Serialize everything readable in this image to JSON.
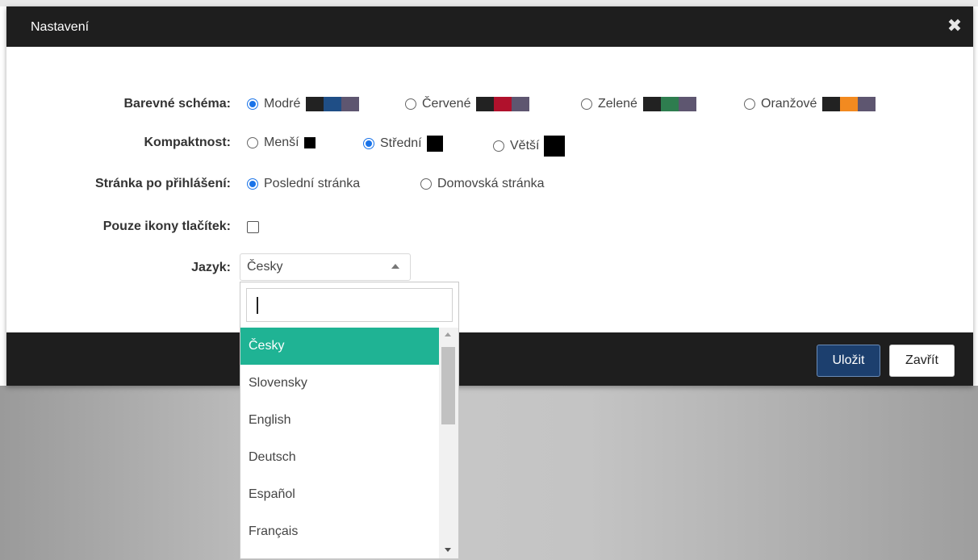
{
  "dialog": {
    "title": "Nastavení",
    "close_icon": "close-x-icon"
  },
  "settings": {
    "color_scheme": {
      "label": "Barevné schéma:",
      "options": [
        {
          "label": "Modré",
          "selected": true,
          "colors": [
            "#222222",
            "#1f4e86",
            "#5e5670"
          ]
        },
        {
          "label": "Červené",
          "selected": false,
          "colors": [
            "#222222",
            "#b0112c",
            "#5e5670"
          ]
        },
        {
          "label": "Zelené",
          "selected": false,
          "colors": [
            "#222222",
            "#2e7d4f",
            "#5e5670"
          ]
        },
        {
          "label": "Oranžové",
          "selected": false,
          "colors": [
            "#222222",
            "#f28a20",
            "#5e5670"
          ]
        }
      ]
    },
    "compactness": {
      "label": "Kompaktnost:",
      "options": [
        {
          "label": "Menší",
          "selected": false
        },
        {
          "label": "Střední",
          "selected": true
        },
        {
          "label": "Větší",
          "selected": false
        }
      ]
    },
    "landing_page": {
      "label": "Stránka po přihlášení:",
      "options": [
        {
          "label": "Poslední stránka",
          "selected": true
        },
        {
          "label": "Domovská stránka",
          "selected": false
        }
      ]
    },
    "icons_only": {
      "label": "Pouze ikony tlačítek:",
      "checked": false
    },
    "language": {
      "label": "Jazyk:",
      "value": "Česky",
      "search_value": "",
      "options": [
        "Česky",
        "Slovensky",
        "English",
        "Deutsch",
        "Español",
        "Français"
      ],
      "highlighted": "Česky"
    }
  },
  "footer": {
    "save_label": "Uložit",
    "close_label": "Zavřít"
  },
  "colors": {
    "header_bg": "#1e1e1e",
    "radio_selected": "#1a73e8",
    "dropdown_highlight": "#1fb394",
    "save_button_bg": "#1c3f6e"
  }
}
